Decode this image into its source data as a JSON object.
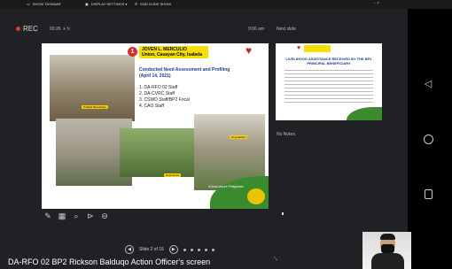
{
  "toolbar": {
    "show_taskbar": "SHOW TASKBAR",
    "display_settings": "DISPLAY SETTINGS ▾",
    "end_slide_show": "END SLIDE SHOW",
    "window_controls": "- ×"
  },
  "status": {
    "rec_label": "REC",
    "timer": "00:26",
    "clock": "9:06 am",
    "next_slide_label": "Next slide"
  },
  "slide": {
    "number": "1",
    "banner_name": "JOVEN L. MERCULIO",
    "banner_location": "Union, Cauayan City, Isabela",
    "heading_line1": "Conducted Need Assessment and Profiling",
    "heading_line2": "(April 14, 2021)",
    "list": [
      "1. DA-RFO 02 Staff",
      "2. DA-CVRC Staff",
      "3. CSWD Staff/BP2 Focal",
      "4. CAO Staff"
    ],
    "tag1": "Profiled Beneficiary",
    "tag2": "Hog House",
    "tag3": "Hog Garden",
    "slogan": "A food-secure Philippines"
  },
  "next_slide": {
    "title": "LIVELIHOOD ASSISTANCE RECEIVED BY THE BP2 PRINCIPAL BENEFICIARY"
  },
  "notes": "No Notes.",
  "slide_nav": {
    "count": "Slide 2 of 16"
  },
  "icons": {
    "pen": "pen-icon",
    "slides": "all-slides-icon",
    "zoom": "zoom-icon",
    "pointer": "pointer-icon",
    "more": "more-icon"
  },
  "colors": {
    "accent_yellow": "#f7e000",
    "brand_green": "#3b8a2e",
    "rec_red": "#e53935"
  },
  "caption": "DA-RFO 02 BP2 Rickson Balduqo Action Officer's screen"
}
